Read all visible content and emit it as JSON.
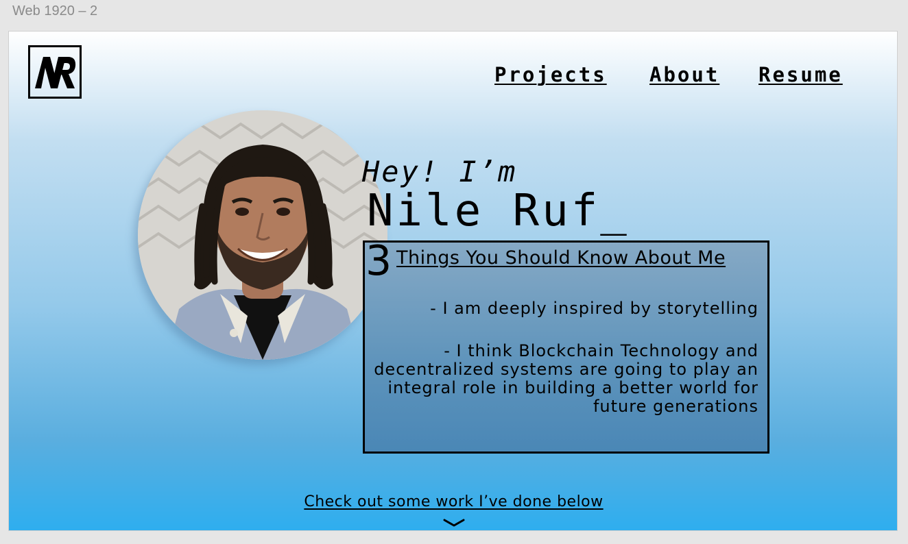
{
  "canvas": {
    "frame_label": "Web 1920 – 2"
  },
  "header": {
    "logo_text": "NR",
    "nav": {
      "projects": "Projects",
      "about": "About",
      "resume": "Resume"
    }
  },
  "hero": {
    "greeting": "Hey! I’m",
    "name": "Nile Ruf_",
    "photo_alt": "portrait-photo"
  },
  "facts": {
    "count": "3",
    "heading": "Things You Should Know About Me",
    "items": [
      "- I am deeply inspired by storytelling",
      "- I think Blockchain Technology and decentralized systems are going to play an integral role in building a better world for future generations"
    ]
  },
  "footer": {
    "cta": "Check out some work I’ve done below",
    "icon": "chevron-down-icon"
  },
  "colors": {
    "gradient_top": "#ffffff",
    "gradient_bottom": "#2eaeef",
    "box_fill": "#5d93bb",
    "text": "#000000"
  }
}
